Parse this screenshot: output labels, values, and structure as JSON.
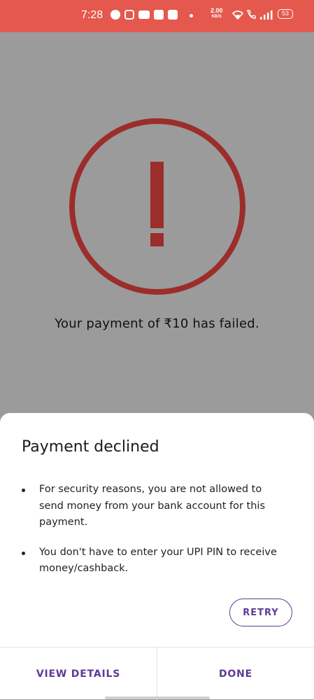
{
  "status_bar": {
    "time": "7:28",
    "net_speed": "2.00",
    "net_speed_unit": "KB/S",
    "battery": "53",
    "icons": [
      "facebook-icon",
      "instagram-icon",
      "youtube-icon",
      "app-icon",
      "app-icon",
      "notification-dot",
      "wifi-icon",
      "call-icon",
      "signal-icon",
      "battery-icon"
    ]
  },
  "screen": {
    "icon": "alert-circle-icon",
    "icon_color": "#9b2d2b",
    "message": "Your payment of ₹10 has failed."
  },
  "sheet": {
    "title": "Payment declined",
    "bullets": [
      "For security reasons, you are not allowed to send money from your bank account for this payment.",
      "You don't have to enter your UPI PIN to receive money/cashback."
    ],
    "retry_label": "RETRY",
    "view_details_label": "VIEW DETAILS",
    "done_label": "DONE",
    "accent_color": "#5f3a96"
  }
}
